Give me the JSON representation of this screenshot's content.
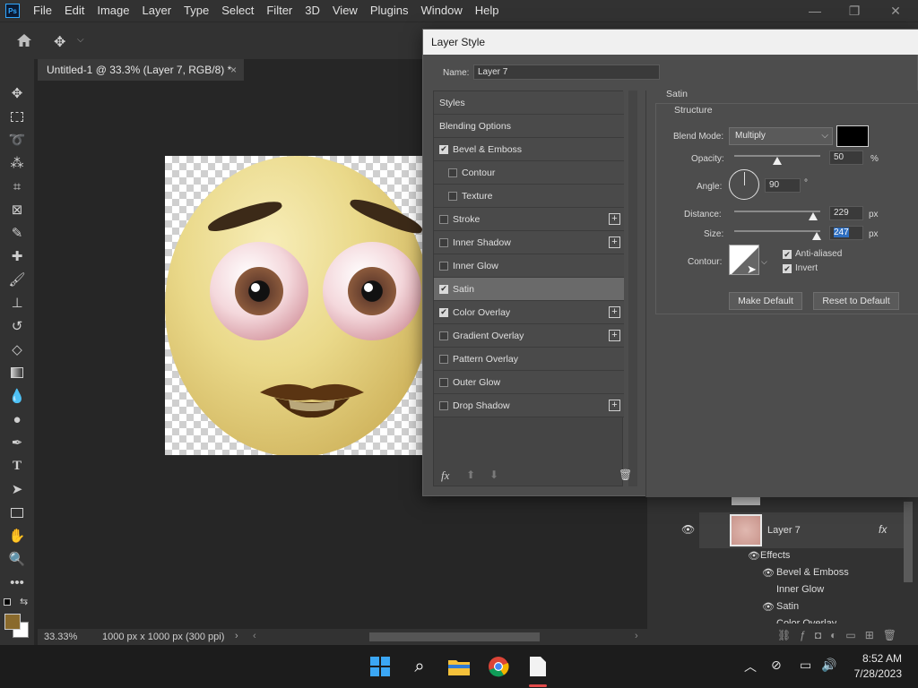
{
  "menubar": {
    "logo": "Ps",
    "items": [
      "File",
      "Edit",
      "Image",
      "Layer",
      "Type",
      "Select",
      "Filter",
      "3D",
      "View",
      "Plugins",
      "Window",
      "Help"
    ]
  },
  "document": {
    "tab_title": "Untitled-1 @ 33.3% (Layer 7, RGB/8) *",
    "close": "×"
  },
  "statusbar": {
    "zoom": "33.33%",
    "doc_info": "1000 px x 1000 px (300 ppi)"
  },
  "dialog": {
    "title": "Layer Style",
    "name_label": "Name:",
    "name_value": "Layer 7",
    "styles": [
      {
        "label": "Styles",
        "checkbox": false,
        "checked": false,
        "plus": false,
        "indent": false,
        "selected": false
      },
      {
        "label": "Blending Options",
        "checkbox": false,
        "checked": false,
        "plus": false,
        "indent": false,
        "selected": false
      },
      {
        "label": "Bevel & Emboss",
        "checkbox": true,
        "checked": true,
        "plus": false,
        "indent": false,
        "selected": false
      },
      {
        "label": "Contour",
        "checkbox": true,
        "checked": false,
        "plus": false,
        "indent": true,
        "selected": false
      },
      {
        "label": "Texture",
        "checkbox": true,
        "checked": false,
        "plus": false,
        "indent": true,
        "selected": false
      },
      {
        "label": "Stroke",
        "checkbox": true,
        "checked": false,
        "plus": true,
        "indent": false,
        "selected": false
      },
      {
        "label": "Inner Shadow",
        "checkbox": true,
        "checked": false,
        "plus": true,
        "indent": false,
        "selected": false
      },
      {
        "label": "Inner Glow",
        "checkbox": true,
        "checked": false,
        "plus": false,
        "indent": false,
        "selected": false
      },
      {
        "label": "Satin",
        "checkbox": true,
        "checked": true,
        "plus": false,
        "indent": false,
        "selected": true
      },
      {
        "label": "Color Overlay",
        "checkbox": true,
        "checked": true,
        "plus": true,
        "indent": false,
        "selected": false
      },
      {
        "label": "Gradient Overlay",
        "checkbox": true,
        "checked": false,
        "plus": true,
        "indent": false,
        "selected": false
      },
      {
        "label": "Pattern Overlay",
        "checkbox": true,
        "checked": false,
        "plus": false,
        "indent": false,
        "selected": false
      },
      {
        "label": "Outer Glow",
        "checkbox": true,
        "checked": false,
        "plus": false,
        "indent": false,
        "selected": false
      },
      {
        "label": "Drop Shadow",
        "checkbox": true,
        "checked": false,
        "plus": true,
        "indent": false,
        "selected": false
      }
    ],
    "fx_label": "fx",
    "satin": {
      "section": "Satin",
      "group": "Structure",
      "blend_mode_label": "Blend Mode:",
      "blend_mode": "Multiply",
      "color": "#000000",
      "opacity_label": "Opacity:",
      "opacity": "50",
      "opacity_unit": "%",
      "opacity_level": 0.5,
      "angle_label": "Angle:",
      "angle": "90",
      "angle_unit": "°",
      "distance_label": "Distance:",
      "distance": "229",
      "distance_unit": "px",
      "distance_level": 0.92,
      "size_label": "Size:",
      "size": "247",
      "size_unit": "px",
      "size_level": 0.96,
      "contour_label": "Contour:",
      "anti_aliased_label": "Anti-aliased",
      "anti_aliased": true,
      "invert_label": "Invert",
      "invert": true,
      "make_default": "Make Default",
      "reset_default": "Reset to Default"
    }
  },
  "layers": {
    "layer_name": "Layer 7",
    "fx": "fx",
    "effects_label": "Effects",
    "effects": [
      "Bevel & Emboss",
      "Inner Glow",
      "Satin",
      "Color Overlay"
    ]
  },
  "taskbar": {
    "time": "8:52 AM",
    "date": "7/28/2023"
  }
}
